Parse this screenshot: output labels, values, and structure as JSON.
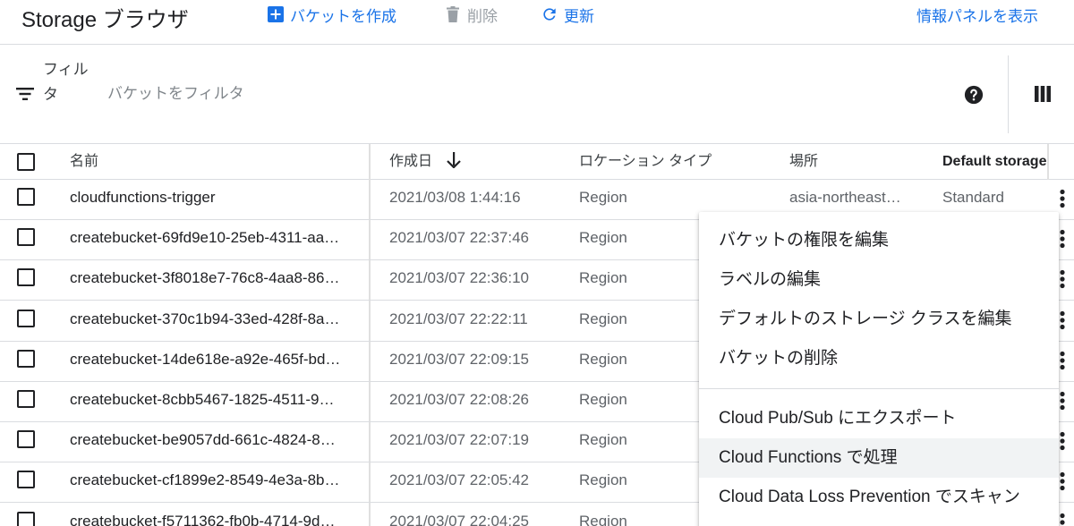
{
  "header": {
    "title": "Storage ブラウザ",
    "create_label": "バケットを作成",
    "delete_label": "削除",
    "refresh_label": "更新",
    "info_panel_label": "情報パネルを表示"
  },
  "filter": {
    "label": "フィルタ",
    "placeholder": "バケットをフィルタ"
  },
  "table": {
    "columns": [
      "名前",
      "作成日",
      "ロケーション タイプ",
      "場所",
      "Default storage"
    ],
    "rows": [
      {
        "name": "cloudfunctions-trigger",
        "date": "2021/03/08 1:44:16",
        "location_type": "Region",
        "location": "asia-northeast…",
        "storage": "Standard"
      },
      {
        "name": "createbucket-69fd9e10-25eb-4311-aa…",
        "date": "2021/03/07 22:37:46",
        "location_type": "Region"
      },
      {
        "name": "createbucket-3f8018e7-76c8-4aa8-86…",
        "date": "2021/03/07 22:36:10",
        "location_type": "Region"
      },
      {
        "name": "createbucket-370c1b94-33ed-428f-8a…",
        "date": "2021/03/07 22:22:11",
        "location_type": "Region"
      },
      {
        "name": "createbucket-14de618e-a92e-465f-bd…",
        "date": "2021/03/07 22:09:15",
        "location_type": "Region"
      },
      {
        "name": "createbucket-8cbb5467-1825-4511-9…",
        "date": "2021/03/07 22:08:26",
        "location_type": "Region"
      },
      {
        "name": "createbucket-be9057dd-661c-4824-8…",
        "date": "2021/03/07 22:07:19",
        "location_type": "Region"
      },
      {
        "name": "createbucket-cf1899e2-8549-4e3a-8b…",
        "date": "2021/03/07 22:05:42",
        "location_type": "Region"
      },
      {
        "name": "createbucket-f5711362-fb0b-4714-9d…",
        "date": "2021/03/07 22:04:25",
        "location_type": "Region"
      }
    ]
  },
  "context_menu": {
    "items": [
      "バケットの権限を編集",
      "ラベルの編集",
      "デフォルトのストレージ クラスを編集",
      "バケットの削除",
      "Cloud Pub/Sub にエクスポート",
      "Cloud Functions で処理",
      "Cloud Data Loss Prevention でスキャン"
    ]
  },
  "colors": {
    "accent": "#1a73e8",
    "disabled": "#9aa0a6",
    "divider": "#dadce0",
    "hover": "#f1f3f4"
  }
}
